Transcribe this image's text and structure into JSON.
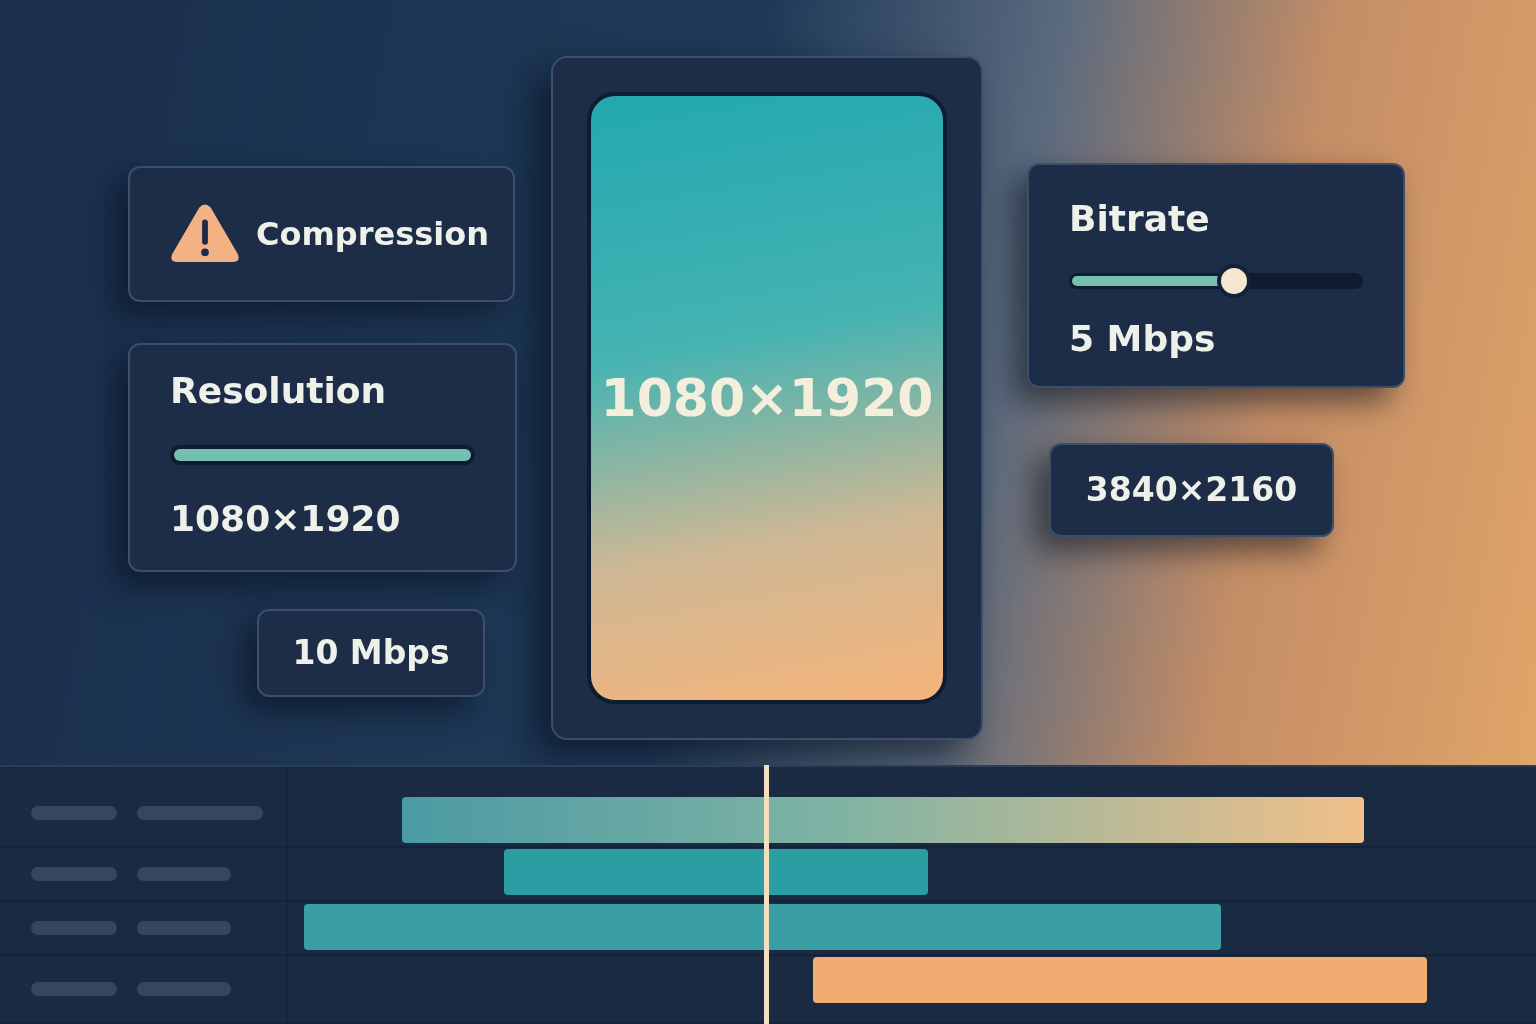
{
  "cards": [
    {
      "kind": "warning",
      "title": "Compression"
    },
    {
      "kind": "bar",
      "title": "Resolution",
      "level": 1.0,
      "value": "1080×1920"
    },
    {
      "kind": "pill",
      "value": "10 Mbps"
    },
    {
      "kind": "slider",
      "title": "Bitrate",
      "level": 0.56,
      "value": "5 Mbps"
    },
    {
      "kind": "pill",
      "value": "3840×2160"
    }
  ],
  "preview": {
    "label": "1080×1920"
  },
  "timeline": {
    "tracks": [
      {
        "clip": {
          "kind": "blend",
          "color": "#4b9aa3"
        }
      },
      {
        "clip": {
          "kind": "solid",
          "color": "#2a9ea3"
        }
      },
      {
        "clip": {
          "kind": "solid",
          "color": "#3a9ea3"
        }
      },
      {
        "clip": {
          "kind": "solid",
          "color": "#f2ac72"
        }
      }
    ]
  }
}
